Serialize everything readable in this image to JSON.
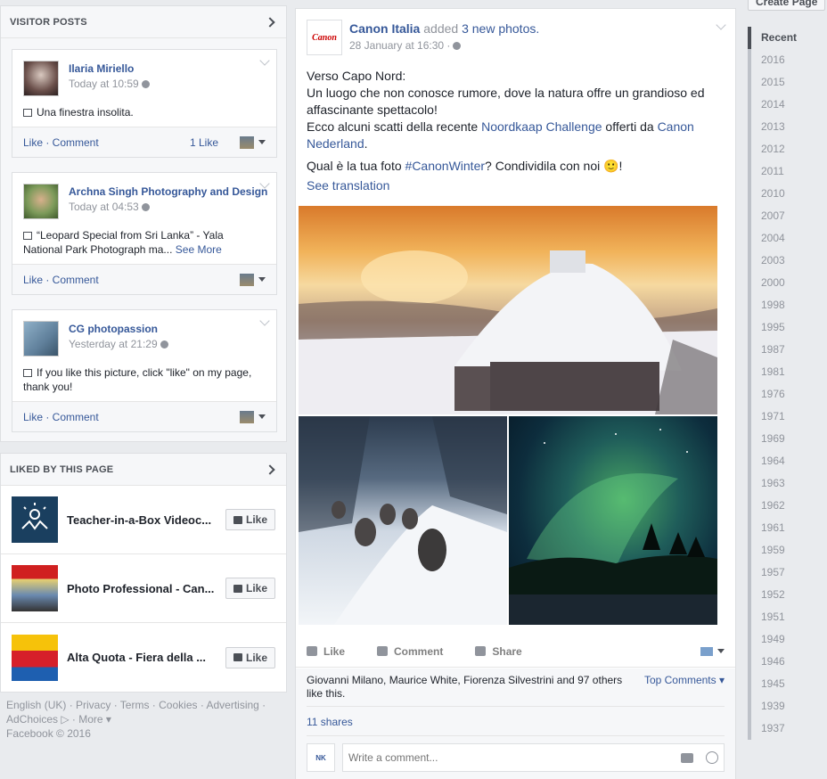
{
  "visitor_posts": {
    "title": "VISITOR POSTS",
    "posts": [
      {
        "author": "Ilaria Miriello",
        "time": "Today at 10:59",
        "text": "Una finestra insolita.",
        "see_more": "",
        "actions": "Like · Comment",
        "likes": "1 Like"
      },
      {
        "author": "Archna Singh Photography and Design",
        "time": "Today at 04:53",
        "text": "“Leopard Special from Sri Lanka” - Yala National Park Photograph ma...",
        "see_more": "See More",
        "actions": "Like · Comment",
        "likes": ""
      },
      {
        "author": "CG photopassion",
        "time": "Yesterday at 21:29",
        "text": "If you like this picture, click \"like\" on my page, thank you!",
        "see_more": "",
        "actions": "Like · Comment",
        "likes": ""
      }
    ]
  },
  "liked_by_page": {
    "title": "LIKED BY THIS PAGE",
    "like_label": "Like",
    "pages": [
      {
        "name": "Teacher-in-a-Box Videoc..."
      },
      {
        "name": "Photo Professional - Can..."
      },
      {
        "name": "Alta Quota - Fiera della ..."
      }
    ]
  },
  "footer": {
    "line1": "English (UK) · Privacy · Terms · Cookies · Advertising ·",
    "line2": "AdChoices ▷ · More ▾",
    "line3": "Facebook © 2016"
  },
  "post": {
    "page_name": "Canon Italia",
    "verb": "added",
    "photo_count": "3 new photos.",
    "time": "28 January at 16:30 ·",
    "logo_text": "Canon",
    "line1": "Verso Capo Nord:",
    "line2": "Un luogo che non conosce rumore, dove la natura offre un grandioso ed affascinante spettacolo!",
    "line3_a": "Ecco alcuni scatti della recente ",
    "line3_link1": "Noordkaap Challenge",
    "line3_b": " offerti da ",
    "line3_link2": "Canon Nederland",
    "line3_c": ".",
    "line4_a": "Qual è la tua foto ",
    "line4_tag": "#CanonWinter",
    "line4_b": "? Condividila con noi 🙂!",
    "see_translation": "See translation",
    "actions": {
      "like": "Like",
      "comment": "Comment",
      "share": "Share"
    },
    "likers": "Giovanni Milano, Maurice White, Fiorenza Silvestrini and 97 others like this.",
    "top_comments": "Top Comments ▾",
    "shares": "11 shares",
    "comment_placeholder": "Write a comment..."
  },
  "right_rail": {
    "create_page": "Create Page",
    "years": [
      "Recent",
      "2016",
      "2015",
      "2014",
      "2013",
      "2012",
      "2011",
      "2010",
      "2007",
      "2004",
      "2003",
      "2000",
      "1998",
      "1995",
      "1987",
      "1981",
      "1976",
      "1971",
      "1969",
      "1964",
      "1963",
      "1962",
      "1961",
      "1959",
      "1957",
      "1952",
      "1951",
      "1949",
      "1946",
      "1945",
      "1939",
      "1937"
    ]
  }
}
